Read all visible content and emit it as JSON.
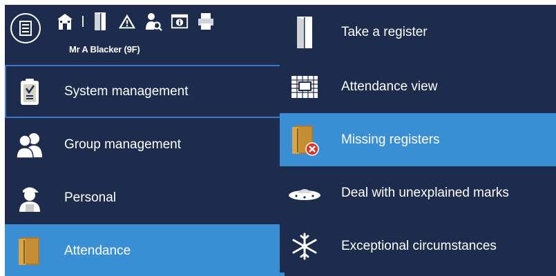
{
  "header": {
    "menu_icon": "menu-document-icon",
    "user_name": "Mr A Blacker (9F)",
    "toolbar": [
      {
        "icon": "school-building-icon"
      },
      {
        "icon": "register-door-icon"
      },
      {
        "icon": "warning-icon"
      },
      {
        "icon": "person-search-icon"
      },
      {
        "icon": "info-window-icon"
      },
      {
        "icon": "printer-icon"
      }
    ]
  },
  "left_menu": {
    "items": [
      {
        "label": "System management",
        "icon": "clipboard-icon",
        "state": "focused"
      },
      {
        "label": "Group management",
        "icon": "group-people-icon",
        "state": "normal"
      },
      {
        "label": "Personal",
        "icon": "person-cap-icon",
        "state": "normal"
      },
      {
        "label": "Attendance",
        "icon": "register-book-icon",
        "state": "active"
      }
    ]
  },
  "submenu": {
    "items": [
      {
        "label": "Take a register",
        "icon": "open-door-icon",
        "state": "normal"
      },
      {
        "label": "Attendance view",
        "icon": "grid-view-icon",
        "state": "normal"
      },
      {
        "label": "Missing registers",
        "icon": "book-missing-icon",
        "state": "selected"
      },
      {
        "label": "Deal with unexplained marks",
        "icon": "ufo-icon",
        "state": "normal"
      },
      {
        "label": "Exceptional circumstances",
        "icon": "snowflake-icon",
        "state": "normal"
      }
    ]
  },
  "colors": {
    "background": "#1d2c4d",
    "selected": "#3a8fd4",
    "focus_border": "#3e77c6",
    "text": "#ffffff"
  }
}
